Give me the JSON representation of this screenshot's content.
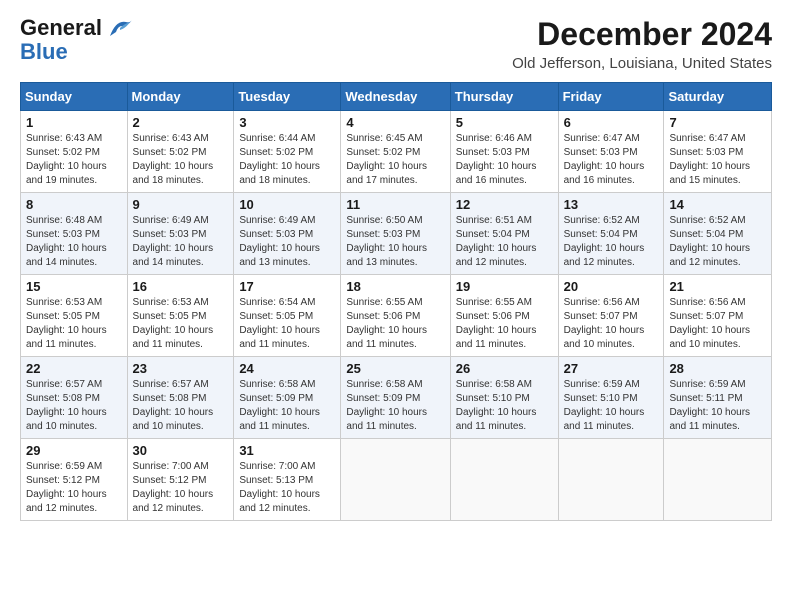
{
  "header": {
    "logo_line1": "General",
    "logo_line2": "Blue",
    "month_title": "December 2024",
    "location": "Old Jefferson, Louisiana, United States"
  },
  "days_of_week": [
    "Sunday",
    "Monday",
    "Tuesday",
    "Wednesday",
    "Thursday",
    "Friday",
    "Saturday"
  ],
  "weeks": [
    [
      {
        "day": "1",
        "sunrise": "6:43 AM",
        "sunset": "5:02 PM",
        "daylight": "10 hours and 19 minutes."
      },
      {
        "day": "2",
        "sunrise": "6:43 AM",
        "sunset": "5:02 PM",
        "daylight": "10 hours and 18 minutes."
      },
      {
        "day": "3",
        "sunrise": "6:44 AM",
        "sunset": "5:02 PM",
        "daylight": "10 hours and 18 minutes."
      },
      {
        "day": "4",
        "sunrise": "6:45 AM",
        "sunset": "5:02 PM",
        "daylight": "10 hours and 17 minutes."
      },
      {
        "day": "5",
        "sunrise": "6:46 AM",
        "sunset": "5:03 PM",
        "daylight": "10 hours and 16 minutes."
      },
      {
        "day": "6",
        "sunrise": "6:47 AM",
        "sunset": "5:03 PM",
        "daylight": "10 hours and 16 minutes."
      },
      {
        "day": "7",
        "sunrise": "6:47 AM",
        "sunset": "5:03 PM",
        "daylight": "10 hours and 15 minutes."
      }
    ],
    [
      {
        "day": "8",
        "sunrise": "6:48 AM",
        "sunset": "5:03 PM",
        "daylight": "10 hours and 14 minutes."
      },
      {
        "day": "9",
        "sunrise": "6:49 AM",
        "sunset": "5:03 PM",
        "daylight": "10 hours and 14 minutes."
      },
      {
        "day": "10",
        "sunrise": "6:49 AM",
        "sunset": "5:03 PM",
        "daylight": "10 hours and 13 minutes."
      },
      {
        "day": "11",
        "sunrise": "6:50 AM",
        "sunset": "5:03 PM",
        "daylight": "10 hours and 13 minutes."
      },
      {
        "day": "12",
        "sunrise": "6:51 AM",
        "sunset": "5:04 PM",
        "daylight": "10 hours and 12 minutes."
      },
      {
        "day": "13",
        "sunrise": "6:52 AM",
        "sunset": "5:04 PM",
        "daylight": "10 hours and 12 minutes."
      },
      {
        "day": "14",
        "sunrise": "6:52 AM",
        "sunset": "5:04 PM",
        "daylight": "10 hours and 12 minutes."
      }
    ],
    [
      {
        "day": "15",
        "sunrise": "6:53 AM",
        "sunset": "5:05 PM",
        "daylight": "10 hours and 11 minutes."
      },
      {
        "day": "16",
        "sunrise": "6:53 AM",
        "sunset": "5:05 PM",
        "daylight": "10 hours and 11 minutes."
      },
      {
        "day": "17",
        "sunrise": "6:54 AM",
        "sunset": "5:05 PM",
        "daylight": "10 hours and 11 minutes."
      },
      {
        "day": "18",
        "sunrise": "6:55 AM",
        "sunset": "5:06 PM",
        "daylight": "10 hours and 11 minutes."
      },
      {
        "day": "19",
        "sunrise": "6:55 AM",
        "sunset": "5:06 PM",
        "daylight": "10 hours and 11 minutes."
      },
      {
        "day": "20",
        "sunrise": "6:56 AM",
        "sunset": "5:07 PM",
        "daylight": "10 hours and 10 minutes."
      },
      {
        "day": "21",
        "sunrise": "6:56 AM",
        "sunset": "5:07 PM",
        "daylight": "10 hours and 10 minutes."
      }
    ],
    [
      {
        "day": "22",
        "sunrise": "6:57 AM",
        "sunset": "5:08 PM",
        "daylight": "10 hours and 10 minutes."
      },
      {
        "day": "23",
        "sunrise": "6:57 AM",
        "sunset": "5:08 PM",
        "daylight": "10 hours and 10 minutes."
      },
      {
        "day": "24",
        "sunrise": "6:58 AM",
        "sunset": "5:09 PM",
        "daylight": "10 hours and 11 minutes."
      },
      {
        "day": "25",
        "sunrise": "6:58 AM",
        "sunset": "5:09 PM",
        "daylight": "10 hours and 11 minutes."
      },
      {
        "day": "26",
        "sunrise": "6:58 AM",
        "sunset": "5:10 PM",
        "daylight": "10 hours and 11 minutes."
      },
      {
        "day": "27",
        "sunrise": "6:59 AM",
        "sunset": "5:10 PM",
        "daylight": "10 hours and 11 minutes."
      },
      {
        "day": "28",
        "sunrise": "6:59 AM",
        "sunset": "5:11 PM",
        "daylight": "10 hours and 11 minutes."
      }
    ],
    [
      {
        "day": "29",
        "sunrise": "6:59 AM",
        "sunset": "5:12 PM",
        "daylight": "10 hours and 12 minutes."
      },
      {
        "day": "30",
        "sunrise": "7:00 AM",
        "sunset": "5:12 PM",
        "daylight": "10 hours and 12 minutes."
      },
      {
        "day": "31",
        "sunrise": "7:00 AM",
        "sunset": "5:13 PM",
        "daylight": "10 hours and 12 minutes."
      },
      null,
      null,
      null,
      null
    ]
  ]
}
